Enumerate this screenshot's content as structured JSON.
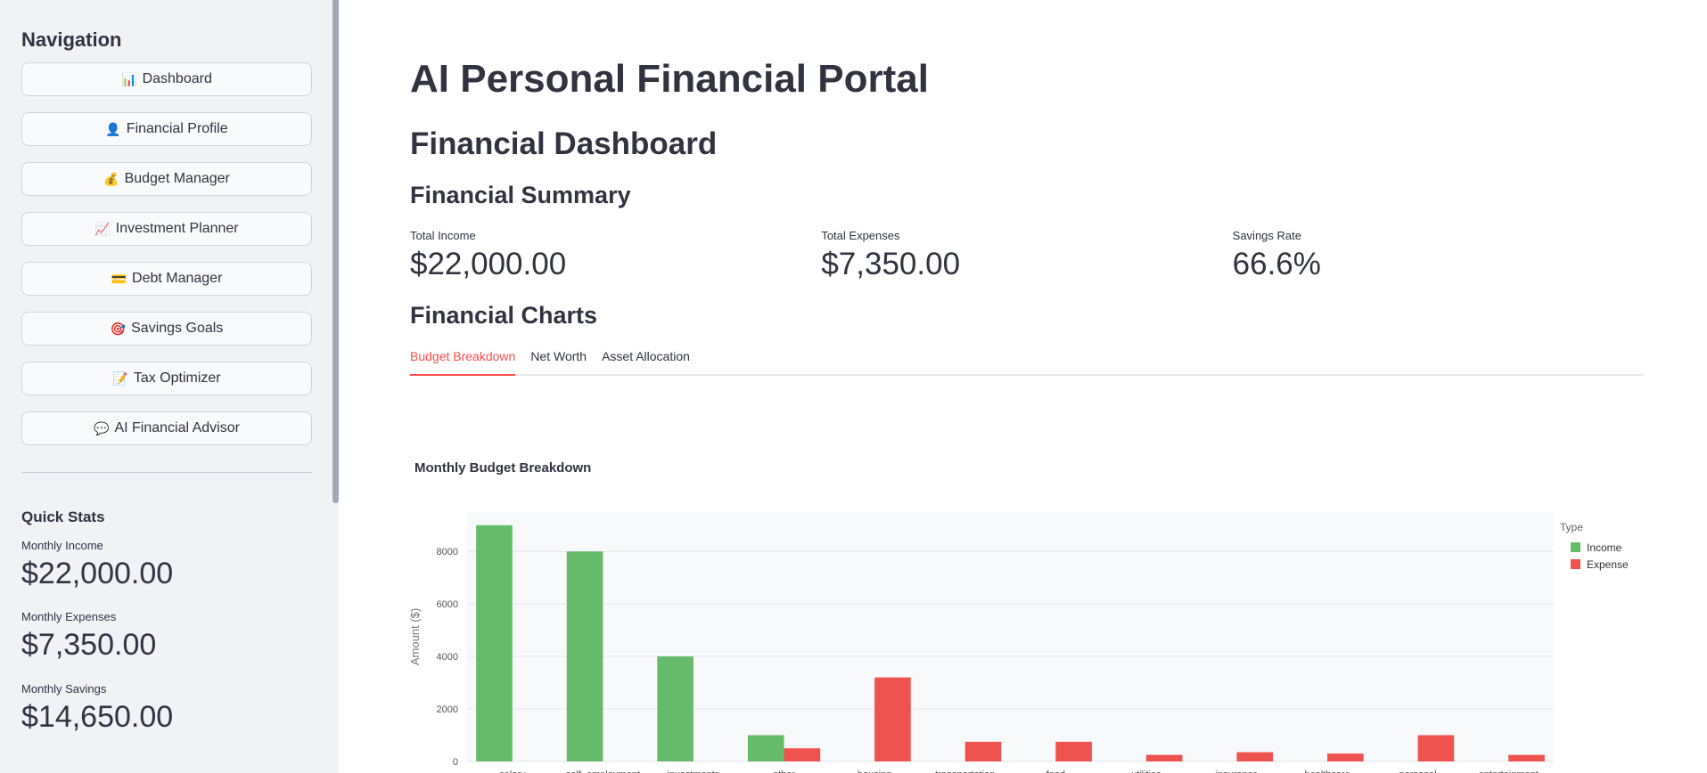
{
  "sidebar": {
    "title": "Navigation",
    "nav": [
      {
        "icon": "📊",
        "label": "Dashboard"
      },
      {
        "icon": "👤",
        "label": "Financial Profile"
      },
      {
        "icon": "💰",
        "label": "Budget Manager"
      },
      {
        "icon": "📈",
        "label": "Investment Planner"
      },
      {
        "icon": "💳",
        "label": "Debt Manager"
      },
      {
        "icon": "🎯",
        "label": "Savings Goals"
      },
      {
        "icon": "📝",
        "label": "Tax Optimizer"
      },
      {
        "icon": "💬",
        "label": "AI Financial Advisor"
      }
    ],
    "quick_stats": {
      "title": "Quick Stats",
      "income_label": "Monthly Income",
      "income_value": "$22,000.00",
      "expenses_label": "Monthly Expenses",
      "expenses_value": "$7,350.00",
      "savings_label": "Monthly Savings",
      "savings_value": "$14,650.00"
    }
  },
  "main": {
    "title": "AI Personal Financial Portal",
    "subtitle": "Financial Dashboard",
    "summary_heading": "Financial Summary",
    "metrics": [
      {
        "label": "Total Income",
        "value": "$22,000.00"
      },
      {
        "label": "Total Expenses",
        "value": "$7,350.00"
      },
      {
        "label": "Savings Rate",
        "value": "66.6%"
      }
    ],
    "charts_heading": "Financial Charts",
    "tabs": [
      "Budget Breakdown",
      "Net Worth",
      "Asset Allocation"
    ],
    "active_tab": "Budget Breakdown"
  },
  "colors": {
    "income": "#66bb6a",
    "expense": "#ef5350",
    "accent": "#ff4b4b"
  },
  "chart_data": {
    "type": "bar",
    "title": "Monthly Budget Breakdown",
    "xlabel": "",
    "ylabel": "Amount ($)",
    "ylim": [
      0,
      9500
    ],
    "yticks": [
      0,
      2000,
      4000,
      6000,
      8000
    ],
    "legend_title": "Type",
    "legend_position": "top-right",
    "categories": [
      "salary",
      "self_employment",
      "investments",
      "other",
      "housing",
      "transportation",
      "food",
      "utilities",
      "insurance",
      "healthcare",
      "personal",
      "entertainment"
    ],
    "series": [
      {
        "name": "Income",
        "values": [
          9000,
          8000,
          4000,
          1000,
          null,
          null,
          null,
          null,
          null,
          null,
          null,
          null
        ]
      },
      {
        "name": "Expense",
        "values": [
          null,
          null,
          null,
          500,
          3200,
          750,
          750,
          250,
          350,
          300,
          1000,
          250
        ]
      }
    ]
  }
}
